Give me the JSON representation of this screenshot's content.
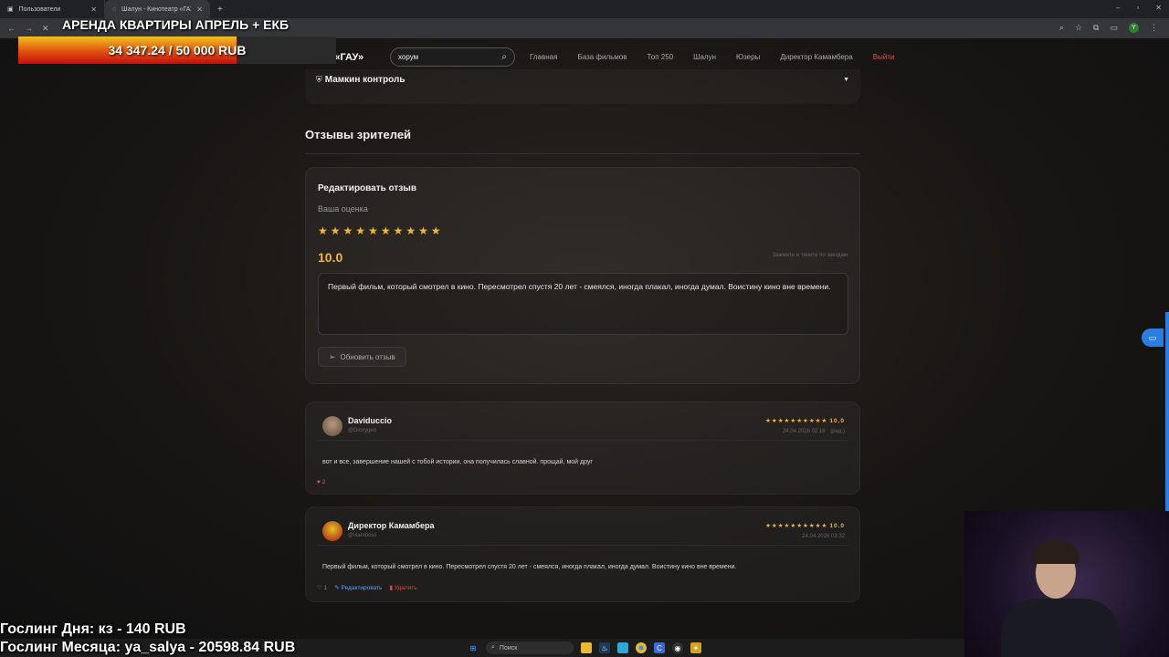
{
  "browser": {
    "tabs": [
      {
        "label": "Пользователи",
        "active": false
      },
      {
        "label": "Шалун - Кинотеатр «ГАУ»",
        "active": true
      }
    ]
  },
  "overlay": {
    "title": "АРЕНДА КВАРТИРЫ АПРЕЛЬ + ЕКБ",
    "goal_text": "34 347.24 / 50 000 RUB",
    "goal_progress": 0.687,
    "line1": "Гослинг Дня: кз - 140 RUB",
    "line2": "Гослинг Месяца: ya_salya - 20598.84 RUB"
  },
  "site": {
    "logo": "Кинотеатр «ГАУ»",
    "search_value": "хорум",
    "nav": [
      "Главная",
      "База фильмов",
      "Топ 250",
      "Шалун",
      "Юзеры",
      "Директор Камамбера",
      "Выйти"
    ]
  },
  "spoiler": {
    "title": "Мамкин контроль"
  },
  "reviews_section": {
    "title": "Отзывы зрителей"
  },
  "edit_form": {
    "title": "Редактировать отзыв",
    "rating_label": "Ваша оценка",
    "stars": 10,
    "score": "10.0",
    "hint": "Зажмите и тяните по звездам",
    "text": "Первый фильм, который смотрел в кино. Пересмотрел спустя 20 лет - смеялся, иногда плакал, иногда думал. Воистину кино вне времени.",
    "button": "Обновить отзыв"
  },
  "reviews": [
    {
      "name": "Daviduccio",
      "handle": "@Dioxygen",
      "stars": "★★★★★★★★★★",
      "score": "10.0",
      "date": "24.04.2026 02:18",
      "edited": "(ред.)",
      "text": "вот и все, завершение нашей с тобой истории, она получилась славной. прощай, мой друг",
      "likes": "2"
    },
    {
      "name": "Директор Камамбера",
      "handle": "@viarxboss",
      "stars": "★★★★★★★★★★",
      "score": "10.0",
      "date": "24.04.2026 03:32",
      "text": "Первый фильм, который смотрел в кино. Пересмотрел спустя 20 лет - смеялся, иногда плакал, иногда думал. Воистину кино вне времени.",
      "likes": "1",
      "edit_label": "Редактировать",
      "delete_label": "Удалить"
    }
  ],
  "taskbar": {
    "search_label": "Поиск"
  },
  "colors": {
    "accent": "#f2b632",
    "danger": "#e04848",
    "link": "#5aa0ff",
    "brand_blue": "#2a7de1"
  }
}
